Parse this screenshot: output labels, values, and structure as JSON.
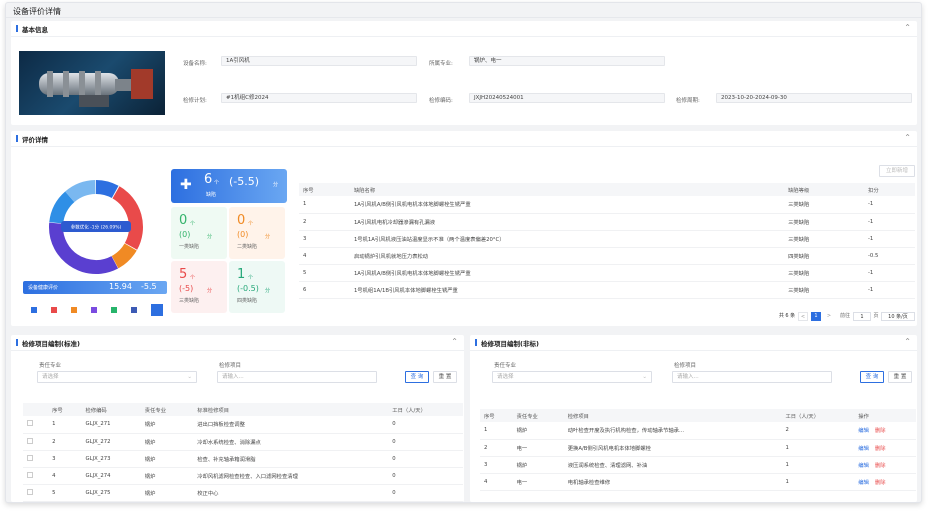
{
  "page_title": "设备评价详情",
  "basic": {
    "title": "基本信息",
    "device_name_label": "设备名称:",
    "device_name": "1A引风机",
    "specialty_label": "所属专业:",
    "specialty": "锅炉、电一",
    "plan_label": "检修计划:",
    "plan": "#1机组C修2024",
    "code_label": "检修编码:",
    "code": "JXJH20240524001",
    "period_label": "检修周期:",
    "period": "2023-10-20-2024-09-30"
  },
  "eval": {
    "title": "评价详情",
    "add_btn": "立即新增",
    "donut_label": "参数优化 -1分 (26.09%)",
    "bar_label": "设备健康评价",
    "bar_score": "15.94",
    "bar_minus": "-5.5",
    "defects": {
      "count": "6",
      "count_unit": "个",
      "label": "缺陷",
      "score": "(-5.5)",
      "score_unit": "分"
    },
    "cards": [
      {
        "count": "0",
        "unit": "个",
        "score": "(0)",
        "sunit": "分",
        "label": "一类缺陷",
        "color": "#34b36b"
      },
      {
        "count": "0",
        "unit": "个",
        "score": "(0)",
        "sunit": "分",
        "label": "二类缺陷",
        "color": "#f08a24"
      },
      {
        "count": "5",
        "unit": "个",
        "score": "(-5)",
        "sunit": "分",
        "label": "三类缺陷",
        "color": "#e94a4a"
      },
      {
        "count": "1",
        "unit": "个",
        "score": "(-0.5)",
        "sunit": "分",
        "label": "四类缺陷",
        "color": "#27a87a"
      }
    ],
    "legend_colors": [
      "#2d6fe0",
      "#e94a4a",
      "#f08a24",
      "#7a4be0",
      "#27b46b",
      "#3c5bb5",
      "#2d6fe0"
    ],
    "table": {
      "headers": [
        "序号",
        "缺陷名称",
        "缺陷等级",
        "扣分"
      ],
      "rows": [
        [
          "1",
          "1A引风机A/B侧引风机电机本体地脚螺栓生锈严重",
          "三类缺陷",
          "-1"
        ],
        [
          "2",
          "1A引风机电机冷却器渗漏有孔漏液",
          "三类缺陷",
          "-1"
        ],
        [
          "3",
          "1号机1A引风机液压油站温度显示不准（两个温度表偏差20°C）",
          "三类缺陷",
          "-1"
        ],
        [
          "4",
          "启动锅炉引风机就地压力表松动",
          "四类缺陷",
          "-0.5"
        ],
        [
          "5",
          "1A引风机A/B侧引风机电机本体地脚螺栓生锈严重",
          "三类缺陷",
          "-1"
        ],
        [
          "6",
          "1号机组1A/1B引风机本体地脚螺栓生锈严重",
          "三类缺陷",
          "-1"
        ]
      ]
    },
    "pager": {
      "total": "共 6 条",
      "prev": "<",
      "page": "1",
      "next": ">",
      "goto": "前往",
      "goto_val": "1",
      "page_unit": "页",
      "size": "10 条/页"
    }
  },
  "std": {
    "title": "检修项目编制(标准)",
    "spec_label": "责任专业",
    "spec_ph": "请选择",
    "item_label": "检修项目",
    "item_ph": "请输入...",
    "query": "查 询",
    "reset": "重 置",
    "headers": [
      "序号",
      "检修编码",
      "责任专业",
      "标准检修项目",
      "工日（人/天）"
    ],
    "rows": [
      [
        "1",
        "GLJX_271",
        "锅炉",
        "进出口挡板检查调整",
        "0"
      ],
      [
        "2",
        "GLJX_272",
        "锅炉",
        "冷却水系统检查、消除漏点",
        "0"
      ],
      [
        "3",
        "GLJX_273",
        "锅炉",
        "检查、补充轴承箱润滑脂",
        "0"
      ],
      [
        "4",
        "GLJX_274",
        "锅炉",
        "冷却风机滤网检查检查、入口滤网检查清理",
        "0"
      ],
      [
        "5",
        "GLJX_275",
        "锅炉",
        "校正中心",
        "0"
      ]
    ]
  },
  "nonstd": {
    "title": "检修项目编制(非标)",
    "spec_label": "责任专业",
    "spec_ph": "请选择",
    "item_label": "检修项目",
    "item_ph": "请输入...",
    "query": "查 询",
    "reset": "重 置",
    "headers": [
      "序号",
      "责任专业",
      "检修项目",
      "工日（人/天）",
      "操作"
    ],
    "edit": "编辑",
    "del": "删除",
    "rows": [
      [
        "1",
        "锅炉",
        "动叶检查开度及执行机构检查，传动轴承节轴承...",
        "2"
      ],
      [
        "2",
        "电一",
        "更换A/B侧引风机电机本体地脚螺栓",
        "1"
      ],
      [
        "3",
        "锅炉",
        "液压润系统检查、清理滤网、补油",
        "1"
      ],
      [
        "4",
        "电一",
        "电机轴承检查维修",
        "1"
      ]
    ]
  }
}
